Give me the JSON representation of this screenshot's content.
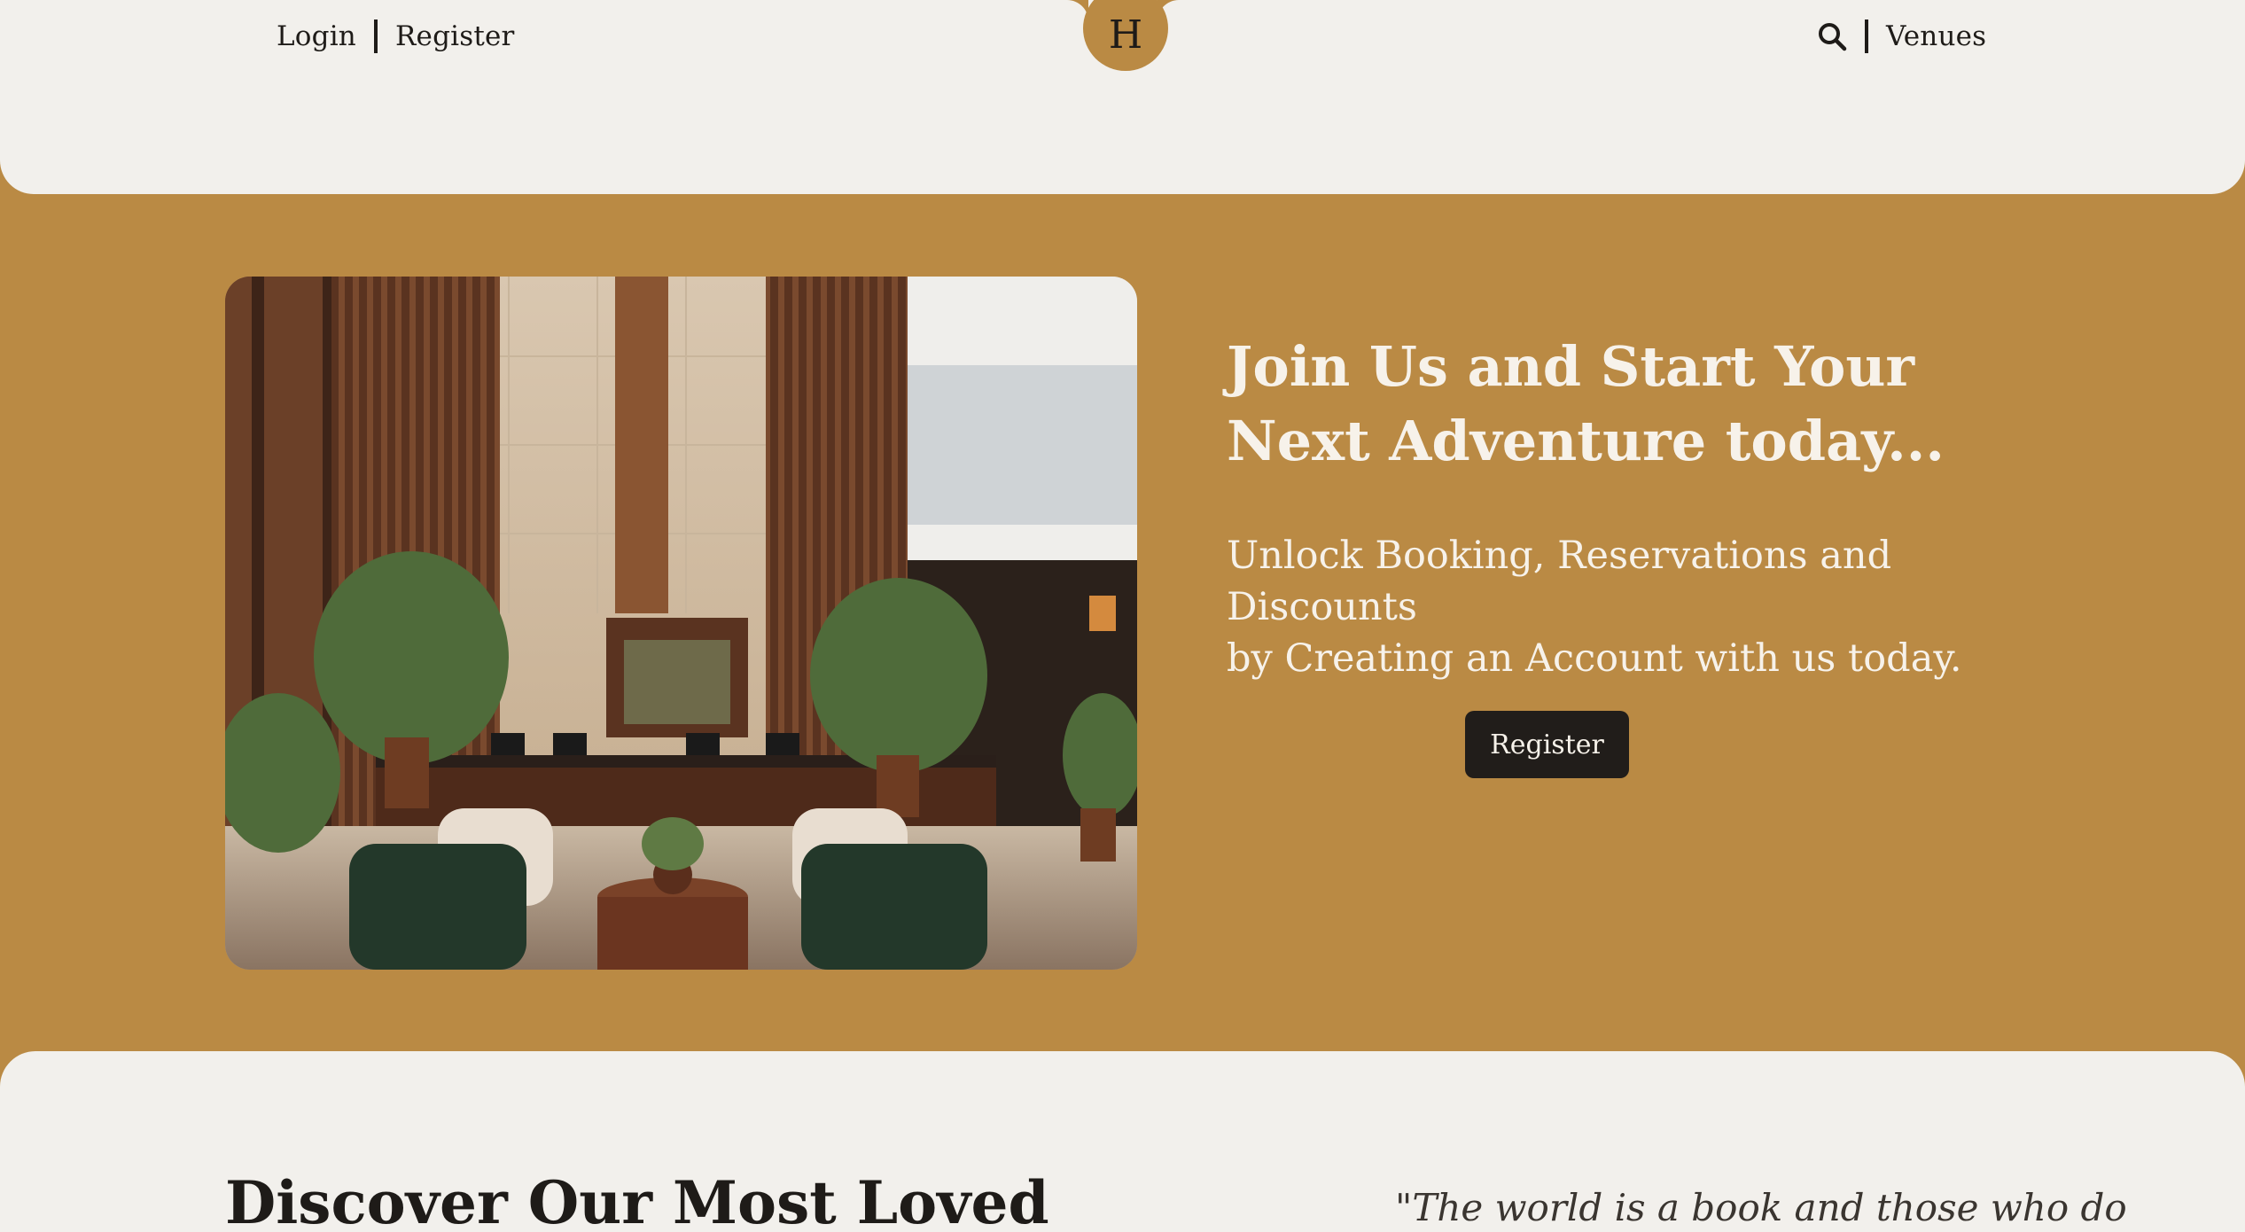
{
  "header": {
    "login_label": "Login",
    "register_label": "Register",
    "logo_letter": "H",
    "search_icon": "search-icon",
    "venues_label": "Venues"
  },
  "hero": {
    "title_line1": "Join Us and Start Your",
    "title_line2": "Next Adventure today...",
    "subtitle_line1": "Unlock Booking, Reservations and Discounts",
    "subtitle_line2": "by Creating an Account with us today.",
    "register_button": "Register",
    "image_alt": "Hotel lobby with green velvet armchairs and reception desk"
  },
  "discover": {
    "title": "Discover Our Most Loved",
    "quote": "\"The world is a book and those who do"
  },
  "colors": {
    "gold": "#BA8A44",
    "cream": "#F2F0EC",
    "dark": "#211D1A",
    "light_text": "#F7F2EA"
  }
}
